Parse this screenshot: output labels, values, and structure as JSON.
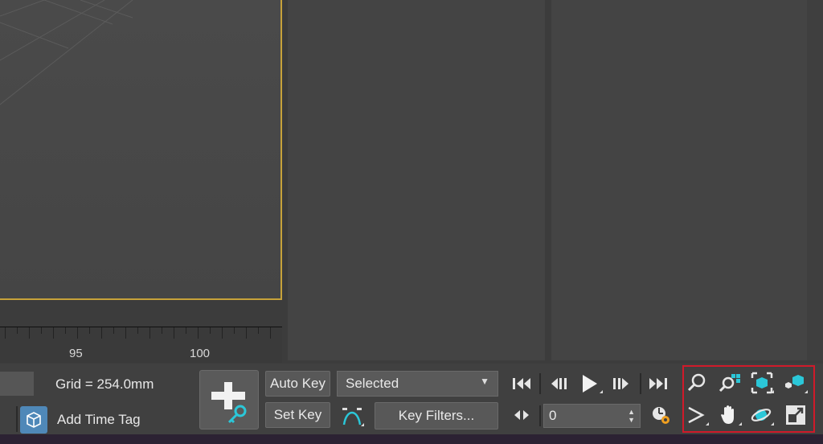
{
  "timeline": {
    "ticks": [
      "95",
      "100"
    ]
  },
  "status": {
    "grid_label": "Grid = 254.0mm",
    "add_time_tag": "Add Time Tag"
  },
  "keys": {
    "auto_key": "Auto Key",
    "set_key": "Set Key",
    "selected_dropdown": "Selected",
    "key_filters": "Key Filters...",
    "frame_value": "0"
  },
  "icons": {
    "playback": [
      "go-to-start-icon",
      "previous-frame-icon",
      "play-icon",
      "next-frame-icon",
      "go-to-end-icon"
    ],
    "navigation": [
      "zoom-icon",
      "zoom-all-icon",
      "zoom-extents-icon",
      "zoom-extents-all-icon",
      "field-of-view-icon",
      "pan-icon",
      "orbit-icon",
      "maximize-viewport-icon"
    ]
  },
  "colors": {
    "viewport_border": "#c7a23a",
    "highlight_box": "#d01a2a",
    "accent_cyan": "#2bc7d8",
    "accent_orange": "#f0a020"
  }
}
